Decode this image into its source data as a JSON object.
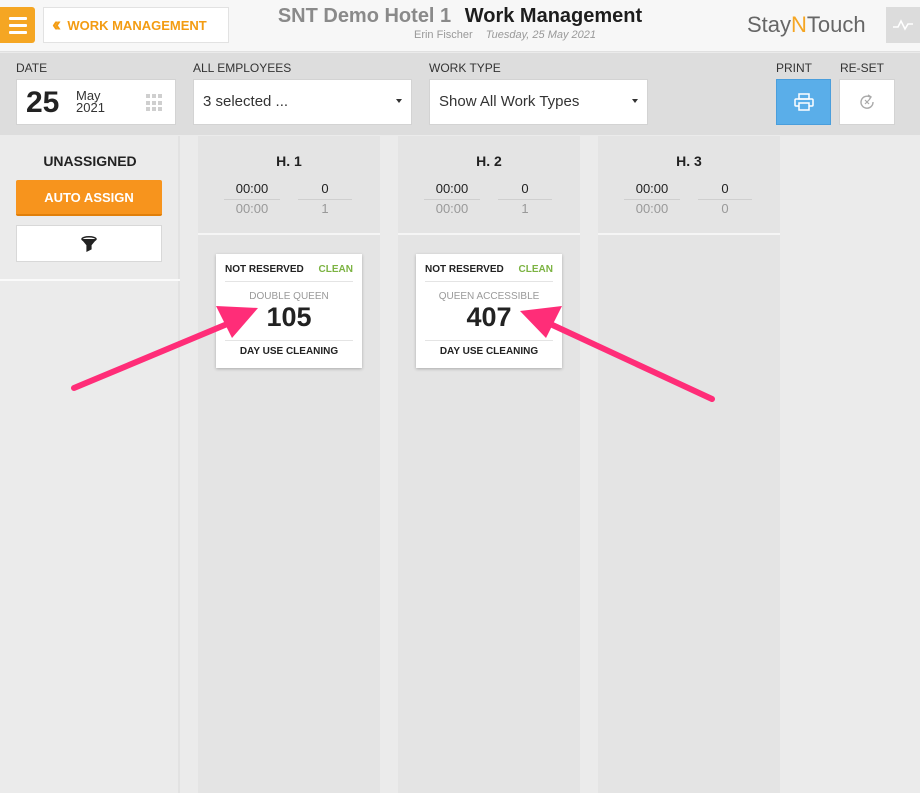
{
  "header": {
    "back_label": "WORK MANAGEMENT",
    "hotel_name": "SNT Demo Hotel 1",
    "page_title": "Work Management",
    "user_name": "Erin Fischer",
    "current_date": "Tuesday, 25 May 2021",
    "brand": {
      "pre": "Stay",
      "mid": "N",
      "post": "Touch"
    }
  },
  "filters": {
    "date_label": "DATE",
    "date_day": "25",
    "date_month": "May",
    "date_year": "2021",
    "employees_label": "ALL EMPLOYEES",
    "employees_value": "3 selected ...",
    "work_type_label": "WORK TYPE",
    "work_type_value": "Show All Work Types",
    "print_label": "PRINT",
    "reset_label": "RE-SET"
  },
  "unassigned": {
    "title": "UNASSIGNED",
    "auto_assign_label": "AUTO ASSIGN"
  },
  "housekeepers": [
    {
      "name": "H. 1",
      "time_assigned": "00:00",
      "rooms_assigned": "0",
      "time_done": "00:00",
      "rooms_done": "1",
      "card": {
        "status": "NOT RESERVED",
        "condition": "CLEAN",
        "room_type": "DOUBLE QUEEN",
        "room_number": "105",
        "task": "DAY USE CLEANING"
      }
    },
    {
      "name": "H. 2",
      "time_assigned": "00:00",
      "rooms_assigned": "0",
      "time_done": "00:00",
      "rooms_done": "1",
      "card": {
        "status": "NOT RESERVED",
        "condition": "CLEAN",
        "room_type": "QUEEN ACCESSIBLE",
        "room_number": "407",
        "task": "DAY USE CLEANING"
      }
    },
    {
      "name": "H. 3",
      "time_assigned": "00:00",
      "rooms_assigned": "0",
      "time_done": "00:00",
      "rooms_done": "0"
    }
  ],
  "colors": {
    "accent_orange": "#f7941d",
    "print_blue": "#5aaee9",
    "clean_green": "#7cb342",
    "annotation_arrow": "#ff2d78"
  }
}
